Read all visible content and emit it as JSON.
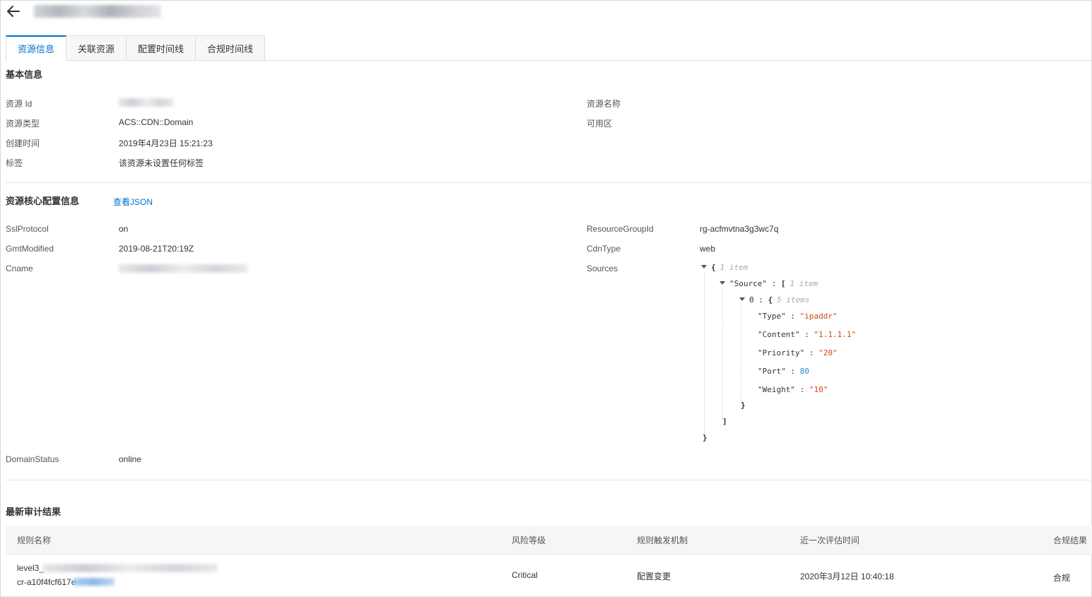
{
  "header": {
    "back_icon": "arrow-left-icon"
  },
  "tabs": [
    {
      "label": "资源信息",
      "active": true
    },
    {
      "label": "关联资源",
      "active": false
    },
    {
      "label": "配置时间线",
      "active": false
    },
    {
      "label": "合规时间线",
      "active": false
    }
  ],
  "basic": {
    "title": "基本信息",
    "resource_id_label": "资源 Id",
    "resource_type_label": "资源类型",
    "resource_type_value": "ACS::CDN::Domain",
    "created_label": "创建时间",
    "created_value": "2019年4月23日 15:21:23",
    "tags_label": "标签",
    "tags_value": "该资源未设置任何标签",
    "resource_name_label": "资源名称",
    "zone_label": "可用区"
  },
  "core": {
    "title": "资源核心配置信息",
    "view_json": "查看JSON",
    "ssl_label": "SslProtocol",
    "ssl_value": "on",
    "gmt_label": "GmtModified",
    "gmt_value": "2019-08-21T20:19Z",
    "cname_label": "Cname",
    "domain_status_label": "DomainStatus",
    "domain_status_value": "online",
    "rg_label": "ResourceGroupId",
    "rg_value": "rg-acfmvtna3g3wc7q",
    "cdntype_label": "CdnType",
    "cdntype_value": "web",
    "sources_label": "Sources"
  },
  "json_view": {
    "open_brace": "{",
    "root_meta": "1 item",
    "source_key": "\"Source\"",
    "colon": ":",
    "open_bracket": "[",
    "source_meta": "1 item",
    "index0": "0",
    "item_meta": "5 items",
    "type_key": "\"Type\"",
    "type_val": "\"ipaddr\"",
    "content_key": "\"Content\"",
    "content_val": "\"1.1.1.1\"",
    "priority_key": "\"Priority\"",
    "priority_val": "\"20\"",
    "port_key": "\"Port\"",
    "port_val": "80",
    "weight_key": "\"Weight\"",
    "weight_val": "\"10\"",
    "close_brace_inner": "}",
    "close_bracket": "]",
    "close_brace": "}"
  },
  "audit": {
    "title": "最新审计结果",
    "columns": [
      "规则名称",
      "风险等级",
      "规则触发机制",
      "近一次评估时间",
      "合规结果"
    ],
    "row": {
      "rule_name_prefix": "level3_",
      "rule_id_prefix": "cr-a10f4fcf617e",
      "risk": "Critical",
      "trigger": "配置变更",
      "eval_time": "2020年3月12日 10:40:18",
      "result": "合规"
    }
  }
}
